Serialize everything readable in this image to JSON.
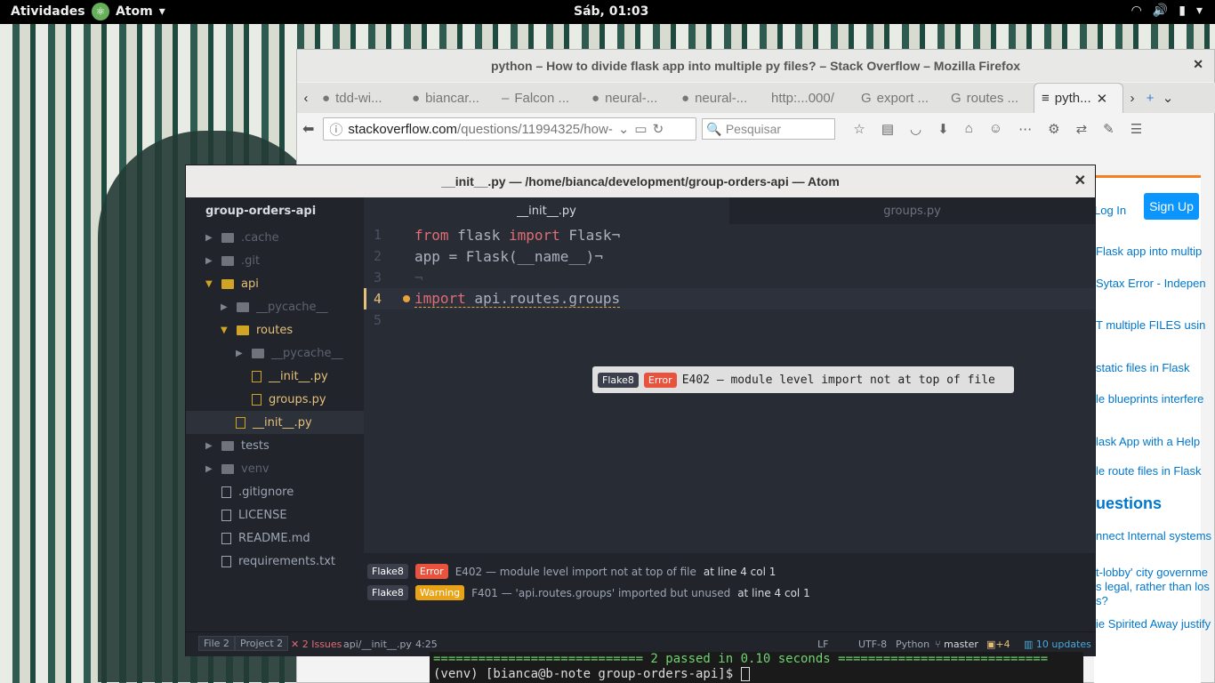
{
  "topbar": {
    "activities": "Atividades",
    "app": "Atom",
    "clock": "Sáb, 01:03"
  },
  "firefox": {
    "title": "python – How to divide flask app into multiple py files? – Stack Overflow – Mozilla Firefox",
    "tabs": [
      "tdd-wi...",
      "biancar...",
      "Falcon ...",
      "neural-...",
      "neural-...",
      "http:...000/",
      "export ...",
      "routes ...",
      "pyth..."
    ],
    "url_domain": "stackoverflow.com",
    "url_path": "/questions/11994325/how-",
    "search_placeholder": "Pesquisar"
  },
  "stackoverflow": {
    "login": "Log In",
    "signup": "Sign Up",
    "links": [
      "Flask app into multip",
      "Sytax Error - Indepen",
      "T multiple FILES usin",
      "static files in Flask",
      "le blueprints interfere",
      "lask App with a Help",
      "le route files in Flask",
      "nnect Internal systems",
      "t-lobby' city governme",
      "s legal, rather than los",
      "s?",
      "ie Spirited Away justify"
    ],
    "heading": "uestions"
  },
  "atom": {
    "title": "__init__.py — /home/bianca/development/group-orders-api — Atom",
    "project": "group-orders-api",
    "tree": [
      {
        "label": ".cache"
      },
      {
        "label": ".git"
      },
      {
        "label": "api"
      },
      {
        "label": "__pycache__"
      },
      {
        "label": "routes"
      },
      {
        "label": "__pycache__"
      },
      {
        "label": "__init__.py"
      },
      {
        "label": "groups.py"
      },
      {
        "label": "__init__.py"
      },
      {
        "label": "tests"
      },
      {
        "label": "venv"
      },
      {
        "label": ".gitignore"
      },
      {
        "label": "LICENSE"
      },
      {
        "label": "README.md"
      },
      {
        "label": "requirements.txt"
      }
    ],
    "tabs": [
      "__init__.py",
      "groups.py"
    ],
    "code": {
      "l1_kw1": "from",
      "l1_mid": " flask ",
      "l1_kw2": "import",
      "l1_end": " Flask¬",
      "l2": "app = Flask(__name__)¬",
      "l3": "¬",
      "l4_kw": "import",
      "l4_rest": " api.routes.groups",
      "numbers": [
        "1",
        "2",
        "3",
        "4",
        "5"
      ]
    },
    "tooltip": {
      "linter": "Flake8",
      "level": "Error",
      "message": "E402 — module level import not at top of file"
    },
    "panel": [
      {
        "linter": "Flake8",
        "level": "Error",
        "message": "E402 — module level import not at top of file",
        "loc": "at line 4 col 1"
      },
      {
        "linter": "Flake8",
        "level": "Warning",
        "message": "F401 — 'api.routes.groups' imported but unused",
        "loc": "at line 4 col 1"
      }
    ],
    "status": {
      "file": "File",
      "file_count": "2",
      "project": "Project",
      "project_count": "2",
      "issues": "2 Issues",
      "path": "api/__init__.py",
      "cursor": "4:25",
      "eol": "LF",
      "encoding": "UTF-8",
      "grammar": "Python",
      "branch": "master",
      "modified": "+4",
      "updates": "10 updates"
    }
  },
  "terminal": {
    "line1": "============================ 2 passed in 0.10 seconds ============================",
    "line2": "(venv) [bianca@b-note group-orders-api]$ "
  },
  "colors": {
    "accent_error": "#e9533d",
    "accent_warning": "#e8a317",
    "atom_bg": "#282c34"
  }
}
